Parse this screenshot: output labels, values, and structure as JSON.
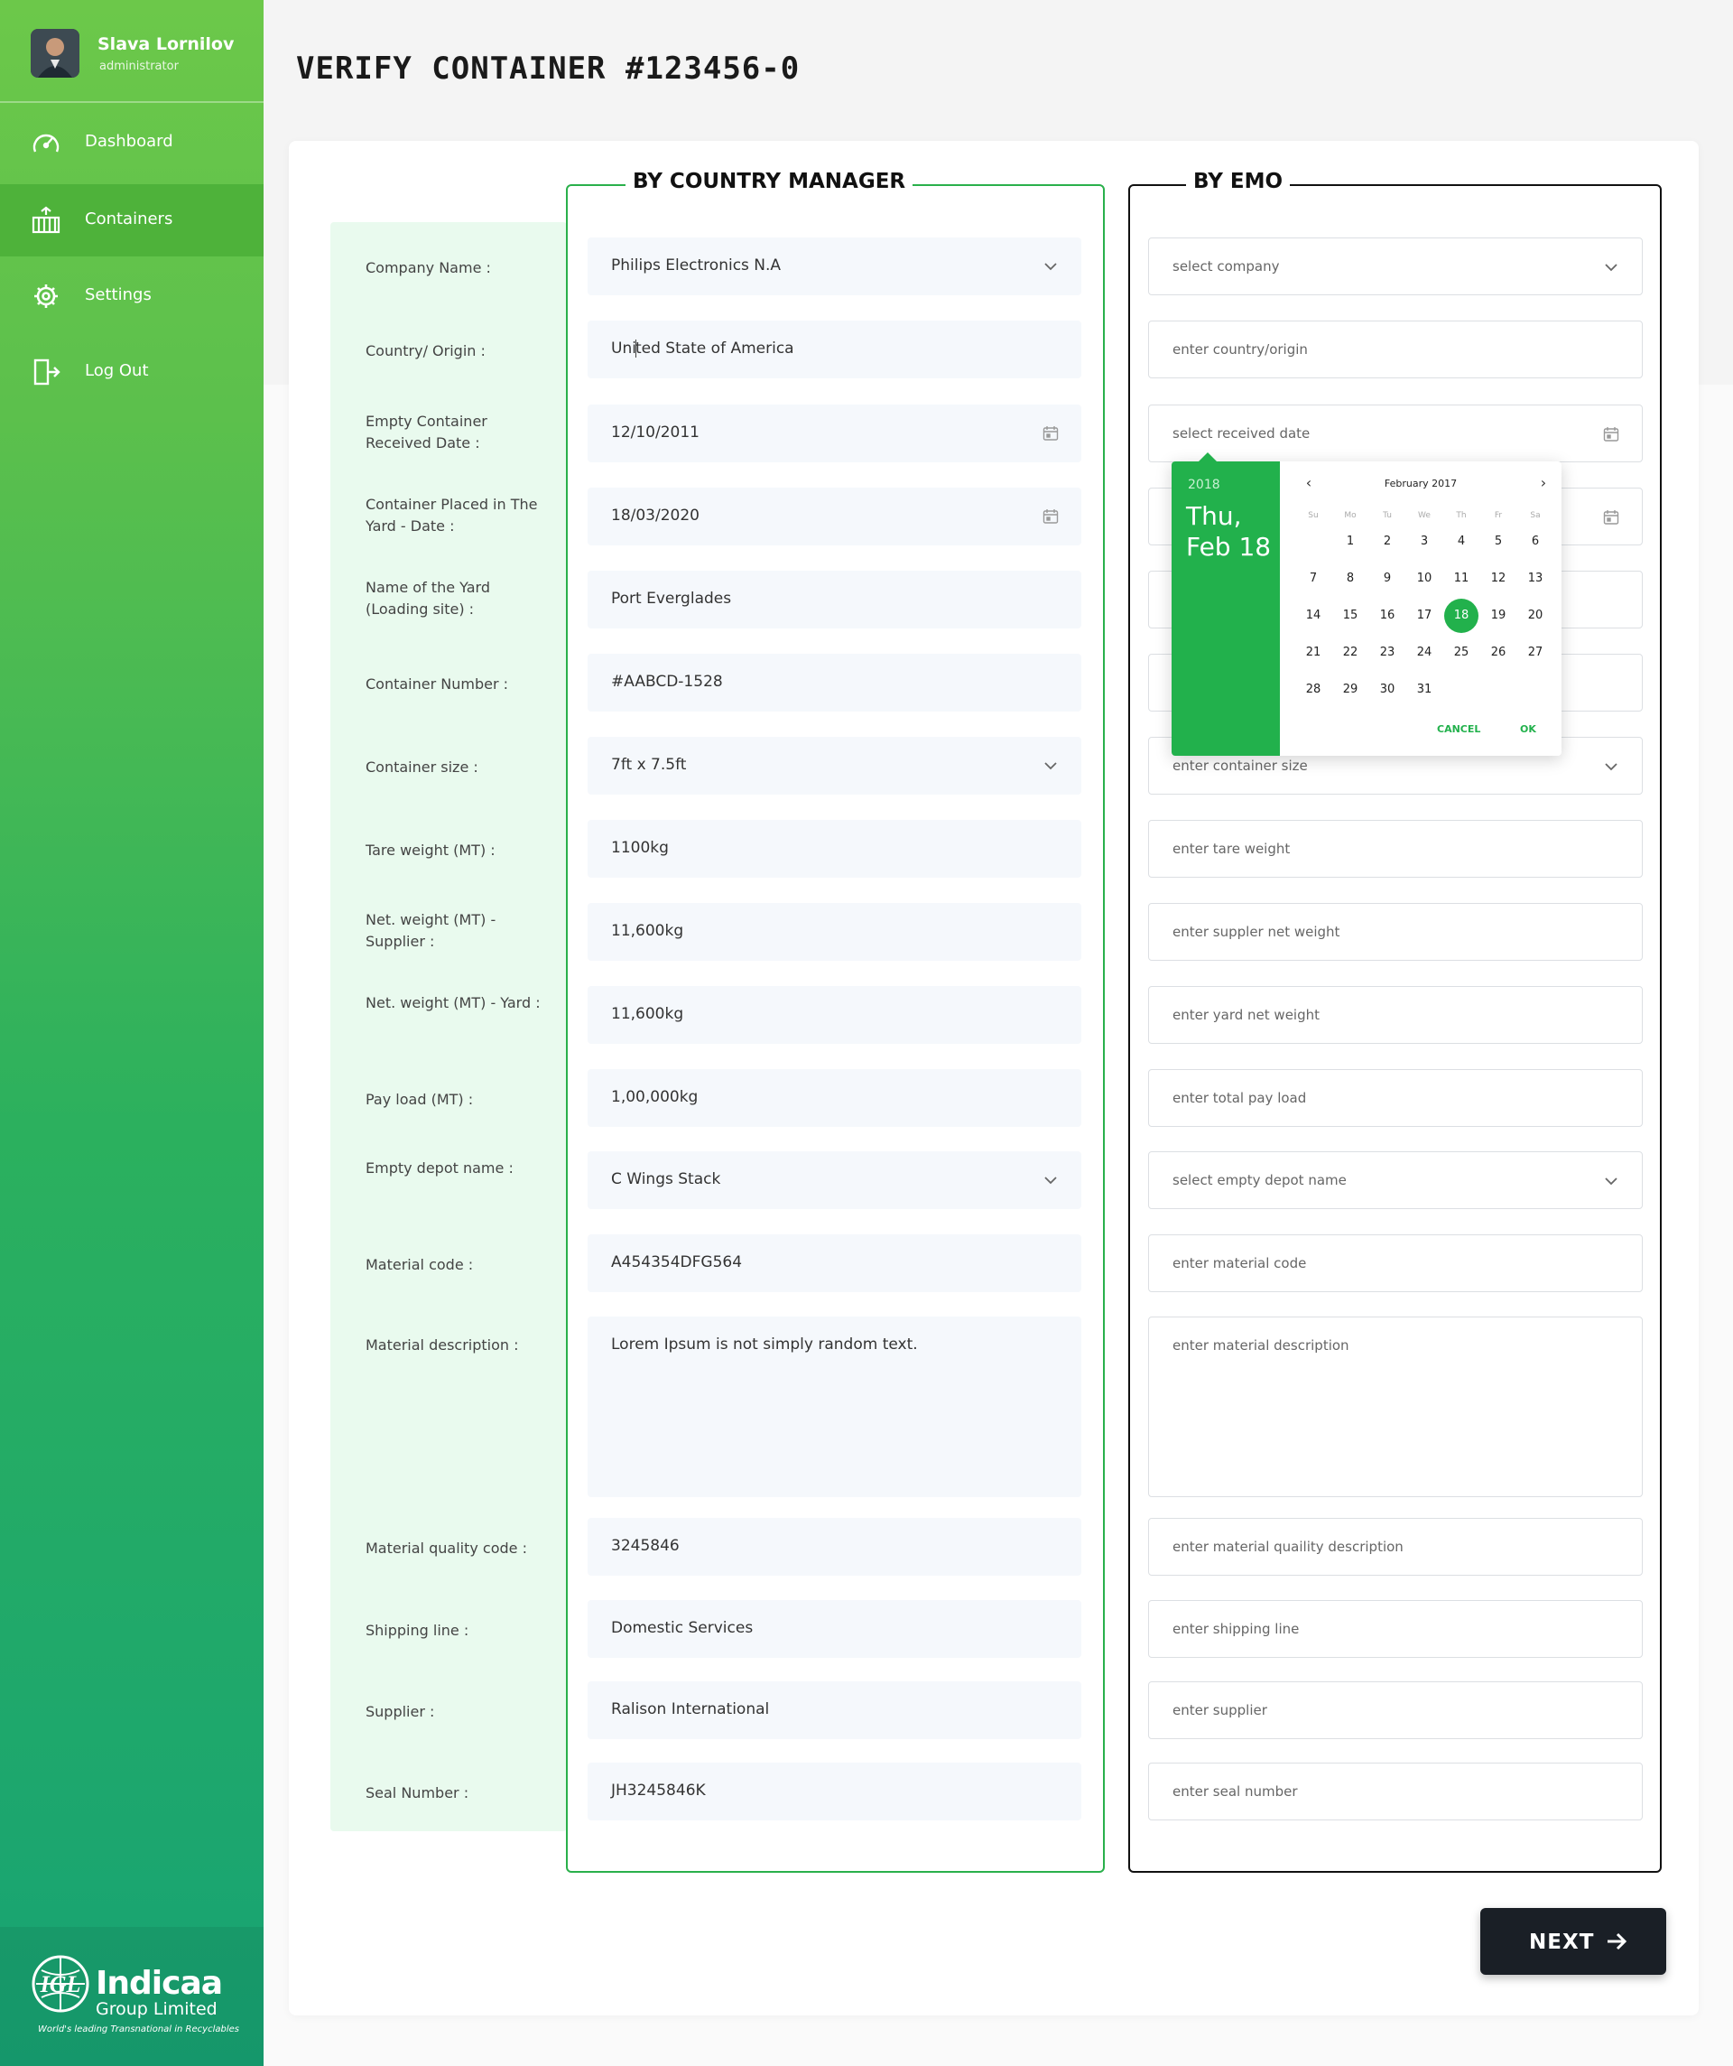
{
  "user": {
    "name": "Slava Lornilov",
    "role": "administrator"
  },
  "nav": [
    {
      "label": "Dashboard",
      "icon": "speedometer-icon"
    },
    {
      "label": "Containers",
      "icon": "container-icon",
      "active": true
    },
    {
      "label": "Settings",
      "icon": "gear-icon"
    },
    {
      "label": "Log Out",
      "icon": "logout-icon"
    }
  ],
  "logo": {
    "name": "Indicaa",
    "subtitle": "Group Limited",
    "tagline": "World's leading Transnational in Recyclables",
    "mark": "IGL"
  },
  "page": {
    "title": "VERIFY CONTAINER #123456-0"
  },
  "sections": {
    "country_manager": "BY COUNTRY MANAGER",
    "emo": "BY EMO"
  },
  "labels": [
    "Company Name :",
    "Country/ Origin :",
    "Empty Container Received Date :",
    "Container Placed in The Yard - Date :",
    "Name of the Yard (Loading site) :",
    "Container Number :",
    "Container size :",
    "Tare weight (MT) :",
    "Net. weight (MT) - Supplier :",
    "Net. weight (MT) - Yard :",
    "Pay load  (MT) :",
    "Empty depot name  :",
    "Material code :",
    "Material description  :",
    "Material quality code :",
    "Shipping line :",
    "Supplier :",
    "Seal Number :"
  ],
  "cm_values": [
    "Philips Electronics N.A",
    "United State of America",
    "12/10/2011",
    "18/03/2020",
    "Port Everglades",
    "#AABCD-1528",
    "7ft x 7.5ft",
    "1100kg",
    "11,600kg",
    "11,600kg",
    "1,00,000kg",
    "C Wings Stack",
    "A454354DFG564",
    "Lorem Ipsum is not simply random text.",
    "3245846",
    "Domestic Services",
    "Ralison International",
    "JH3245846K"
  ],
  "emo_placeholders": [
    "select company",
    "enter country/origin",
    "select received date",
    "",
    "",
    "",
    "enter container size",
    "enter tare weight",
    "enter suppler net weight",
    "enter yard net weight",
    "enter total pay load",
    "select empty depot name",
    "enter material code",
    "enter material description",
    "enter material quaility description",
    "enter shipping line",
    "enter supplier",
    "enter seal number"
  ],
  "datepicker": {
    "year": "2018",
    "weekday": "Thu,",
    "date": "Feb 18",
    "month_label": "February 2017",
    "weekdays": [
      "Su",
      "Mo",
      "Tu",
      "We",
      "Th",
      "Fr",
      "Sa"
    ],
    "days": [
      "1",
      "2",
      "3",
      "4",
      "5",
      "6",
      "7",
      "8",
      "9",
      "10",
      "11",
      "12",
      "13",
      "14",
      "15",
      "16",
      "17",
      "18",
      "19",
      "20",
      "21",
      "22",
      "23",
      "24",
      "25",
      "26",
      "27",
      "28",
      "29",
      "30",
      "31"
    ],
    "selected": "18",
    "cancel": "CANCEL",
    "ok": "OK"
  },
  "next_label": "NEXT",
  "colors": {
    "green": "#22b14c",
    "dark": "#1a1f26",
    "label_bg": "#e9faee"
  }
}
